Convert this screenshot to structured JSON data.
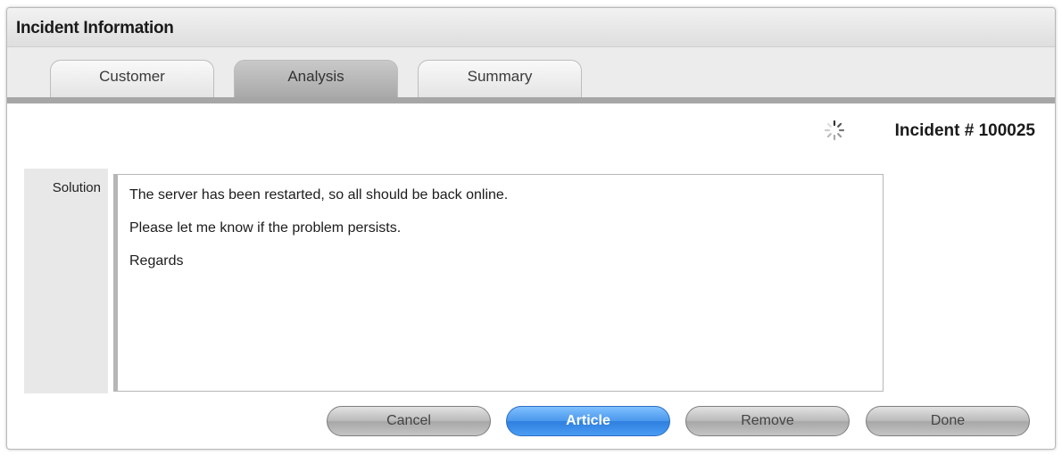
{
  "panel": {
    "title": "Incident Information"
  },
  "tabs": [
    {
      "label": "Customer"
    },
    {
      "label": "Analysis"
    },
    {
      "label": "Summary"
    }
  ],
  "active_tab": "Analysis",
  "incident": {
    "number_label": "Incident # 100025"
  },
  "solution": {
    "label": "Solution",
    "lines": [
      "The server has been restarted, so all should be back online.",
      "Please let me know if the problem persists.",
      "Regards"
    ]
  },
  "buttons": {
    "cancel": "Cancel",
    "article": "Article",
    "remove": "Remove",
    "done": "Done"
  },
  "icons": {
    "loading": "loading-spinner-icon"
  },
  "colors": {
    "primary_button": "#4a97ec",
    "tab_band": "#a6a6a6"
  }
}
